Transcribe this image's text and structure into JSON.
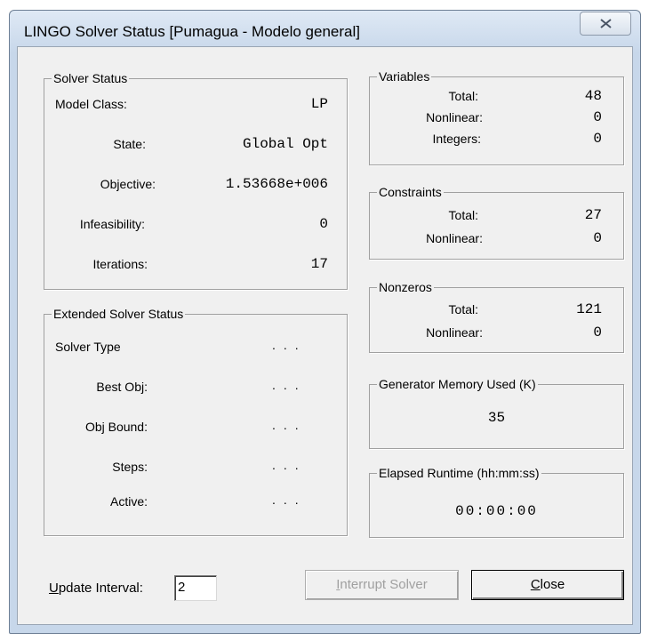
{
  "window": {
    "title": "LINGO Solver Status [Pumagua - Modelo general]"
  },
  "solver_status": {
    "legend": "Solver Status",
    "rows": [
      {
        "label": "Model Class:",
        "value": "LP"
      },
      {
        "label": "State:",
        "value": "Global Opt"
      },
      {
        "label": "Objective:",
        "value": "1.53668e+006"
      },
      {
        "label": "Infeasibility:",
        "value": "0"
      },
      {
        "label": "Iterations:",
        "value": "17"
      }
    ]
  },
  "extended_status": {
    "legend": "Extended Solver Status",
    "rows": [
      {
        "label": "Solver Type",
        "value": "..."
      },
      {
        "label": "Best Obj:",
        "value": "..."
      },
      {
        "label": "Obj Bound:",
        "value": "..."
      },
      {
        "label": "Steps:",
        "value": "..."
      },
      {
        "label": "Active:",
        "value": "..."
      }
    ]
  },
  "variables": {
    "legend": "Variables",
    "rows": [
      {
        "label": "Total:",
        "value": "48"
      },
      {
        "label": "Nonlinear:",
        "value": "0"
      },
      {
        "label": "Integers:",
        "value": "0"
      }
    ]
  },
  "constraints": {
    "legend": "Constraints",
    "rows": [
      {
        "label": "Total:",
        "value": "27"
      },
      {
        "label": "Nonlinear:",
        "value": "0"
      }
    ]
  },
  "nonzeros": {
    "legend": "Nonzeros",
    "rows": [
      {
        "label": "Total:",
        "value": "121"
      },
      {
        "label": "Nonlinear:",
        "value": "0"
      }
    ]
  },
  "generator_memory": {
    "legend": "Generator Memory Used (K)",
    "value": "35"
  },
  "elapsed_runtime": {
    "legend": "Elapsed Runtime (hh:mm:ss)",
    "value": "00:00:00"
  },
  "footer": {
    "update_interval_label_u": "U",
    "update_interval_label_rest": "pdate Interval:",
    "update_interval_value": "2",
    "interrupt_label_u": "I",
    "interrupt_label_rest": "nterrupt Solver",
    "close_label_u": "C",
    "close_label_rest": "lose"
  },
  "colors": {
    "frame": "#c7d7ea",
    "client": "#f0f0f0",
    "disabled_text": "#a0a0a0"
  }
}
